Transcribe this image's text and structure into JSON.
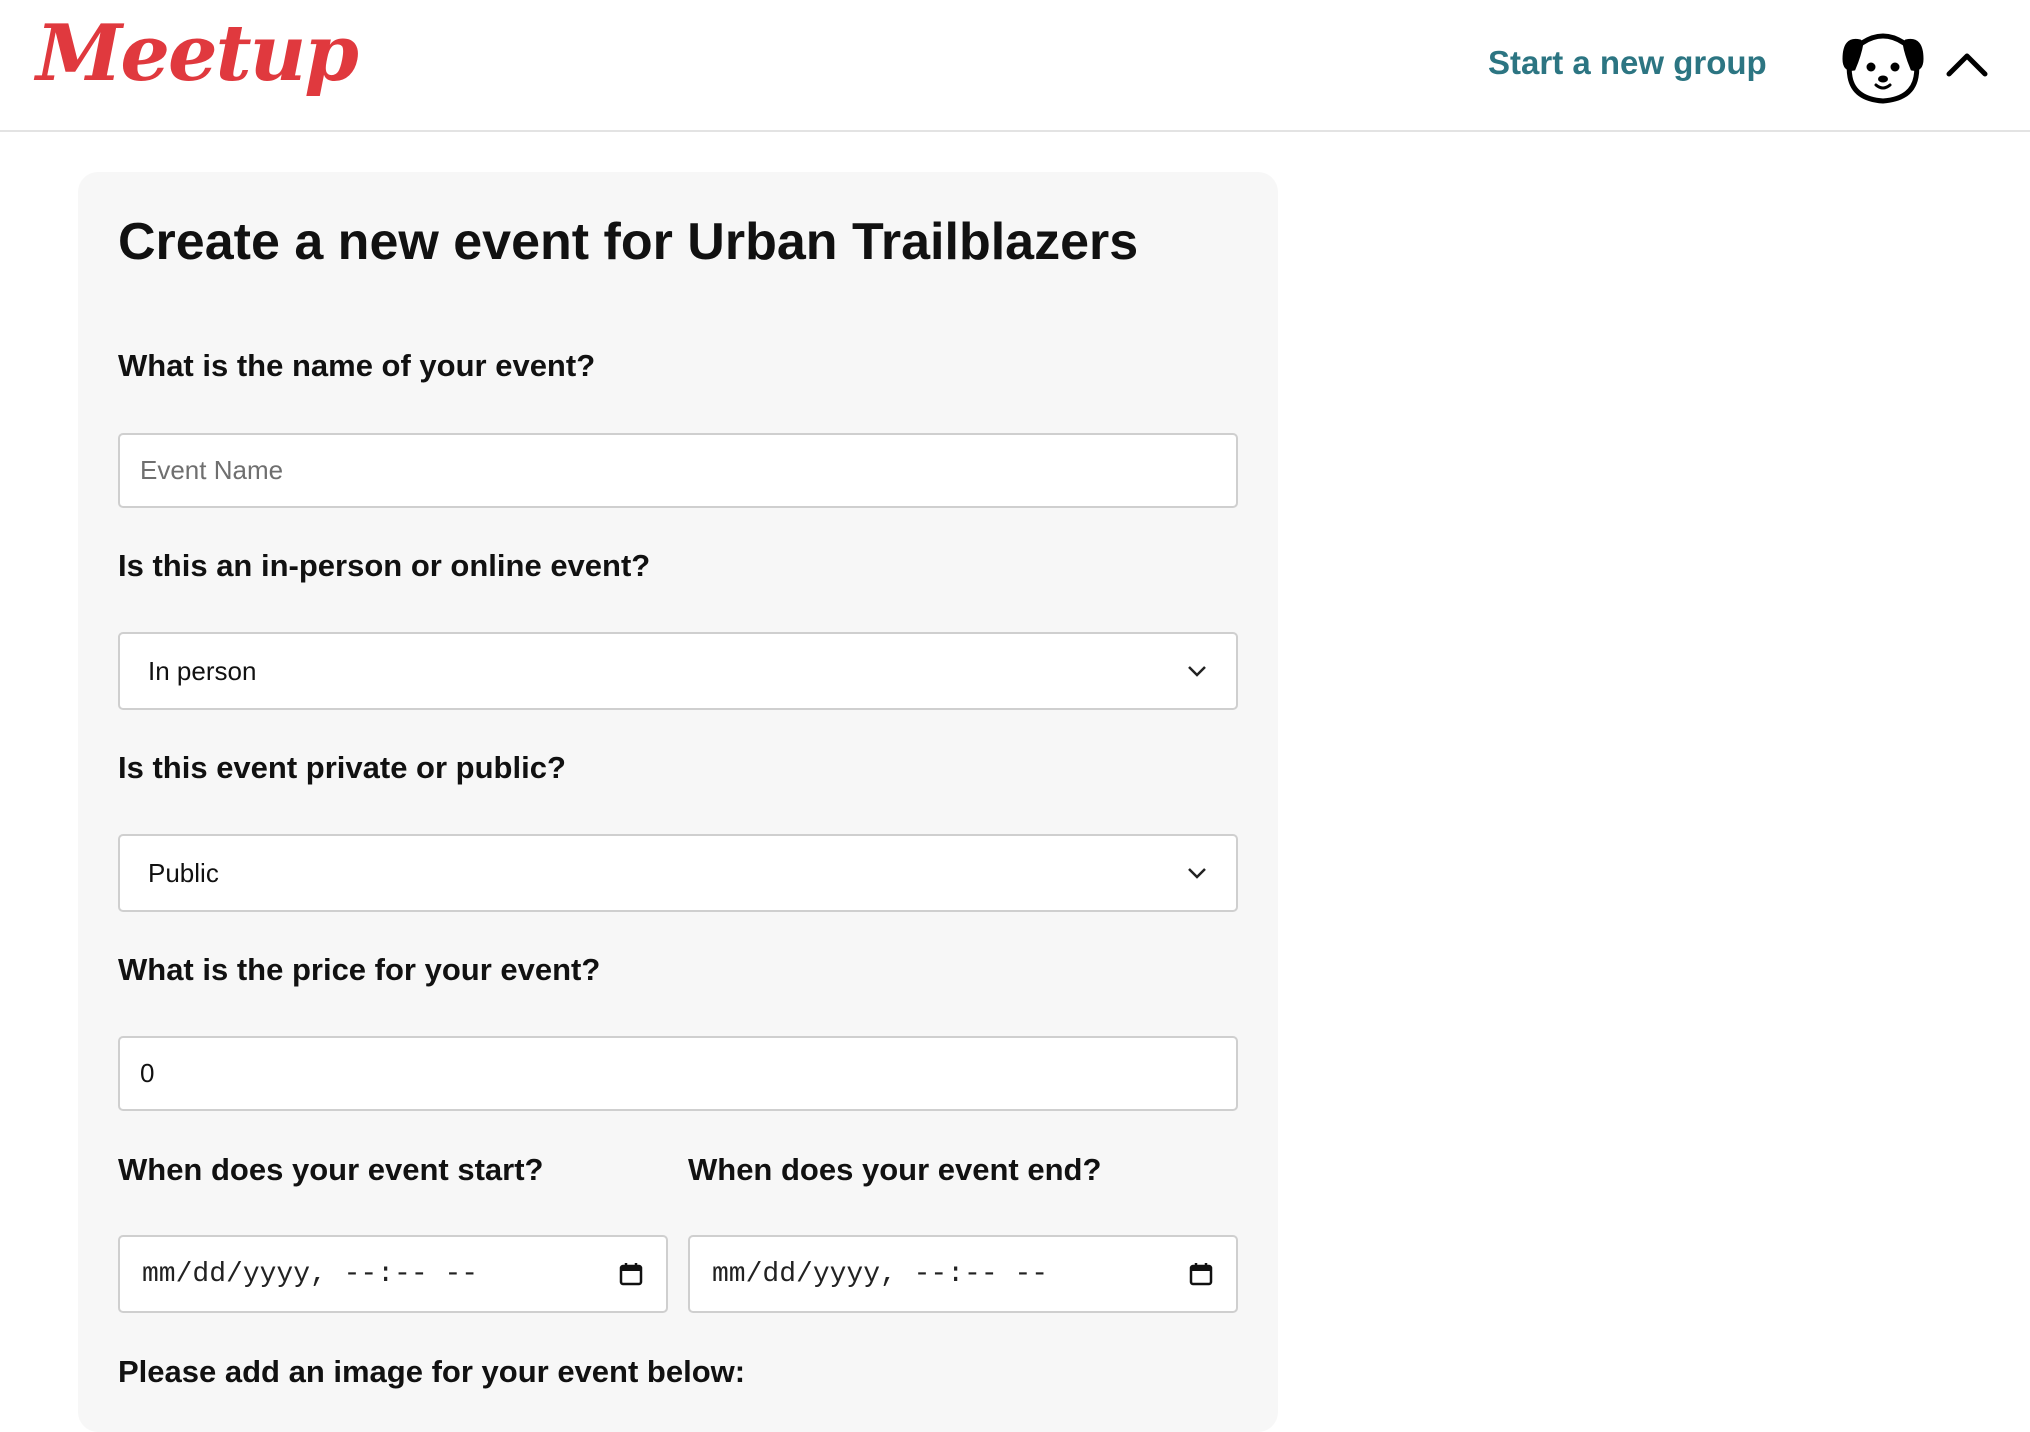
{
  "header": {
    "logo_text": "Meetup",
    "start_group_label": "Start a new group",
    "avatar_icon": "dog-face-icon",
    "menu_icon": "chevron-up-icon",
    "brand_color": "#e0393e",
    "link_color": "#2c7582"
  },
  "form": {
    "title": "Create a new event for Urban Trailblazers",
    "name_label": "What is the name of your event?",
    "name_placeholder": "Event Name",
    "name_value": "",
    "type_label": "Is this an in-person or online event?",
    "type_value": "In person",
    "privacy_label": "Is this event private or public?",
    "privacy_value": "Public",
    "price_label": "What is the price for your event?",
    "price_value": "0",
    "start_label": "When does your event start?",
    "start_value": "mm/dd/yyyy, --:-- --",
    "end_label": "When does your event end?",
    "end_value": "mm/dd/yyyy, --:-- --",
    "image_label": "Please add an image for your event below:"
  }
}
